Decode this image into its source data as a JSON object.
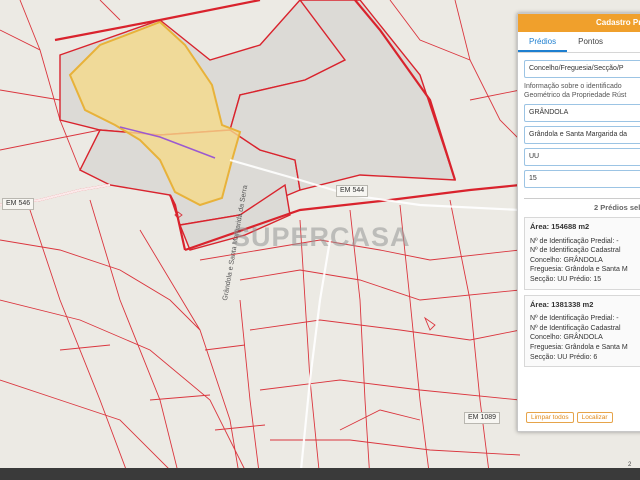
{
  "map": {
    "watermark": "SUPERCASA",
    "road_labels": [
      "EM 546",
      "EM 544",
      "EM 1089"
    ],
    "vertical_road_label": "Grândola e Santa Margarida da Serra",
    "scale_fragment": "2"
  },
  "panel": {
    "title": "Cadastro Pre",
    "tabs": [
      {
        "label": "Prédios",
        "active": true
      },
      {
        "label": "Pontos",
        "active": false
      }
    ],
    "fields": [
      {
        "value": "Concelho/Freguesia/Secção/P"
      },
      {
        "value": "GRÂNDOLA"
      },
      {
        "value": "Grândola e Santa Margarida da"
      },
      {
        "value": "UU"
      },
      {
        "value": "15"
      }
    ],
    "info_text": "Informação sobre o identificado Geométrico da Propriedade Rúst",
    "selected_count": "2 Prédios sele",
    "cards": [
      {
        "area": "Área: 154688 m2",
        "lines": [
          "Nº de Identificação Predial: -",
          "Nº de Identificação Cadastral",
          "Concelho: GRÂNDOLA",
          "Freguesia: Grândola e Santa M",
          "Secção: UU     Prédio: 15"
        ]
      },
      {
        "area": "Área: 1381338 m2",
        "lines": [
          "Nº de Identificação Predial: -",
          "Nº de Identificação Cadastral",
          "Concelho: GRÂNDOLA",
          "Freguesia: Grândola e Santa M",
          "Secção: UU     Prédio: 6"
        ]
      }
    ],
    "buttons": {
      "clear": "Limpar todos",
      "locate": "Localizar"
    }
  },
  "colors": {
    "parcel_line": "#d9232d",
    "highlight_fill": "#f5d98a",
    "highlight_stroke": "#e8b23a",
    "panel_header": "#f0a02c",
    "tab_active": "#1e7fd0"
  }
}
